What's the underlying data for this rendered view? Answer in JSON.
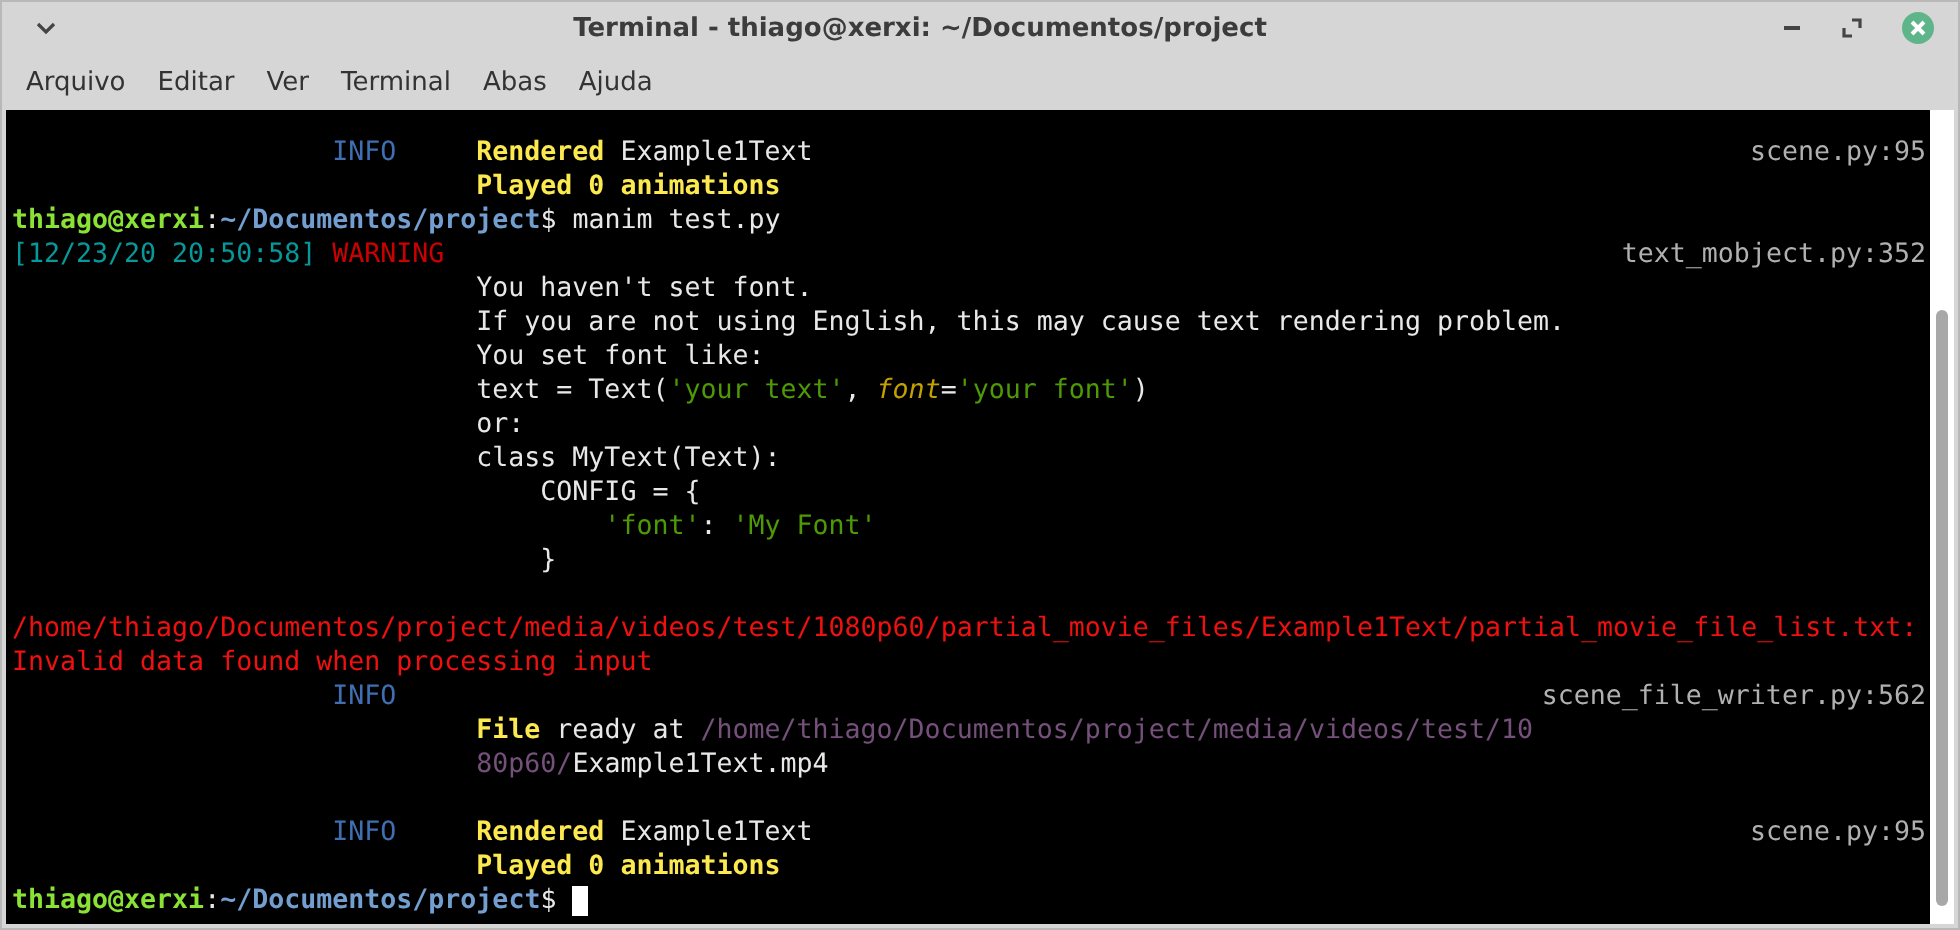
{
  "window": {
    "title": "Terminal - thiago@xerxi: ~/Documentos/project"
  },
  "menu": [
    "Arquivo",
    "Editar",
    "Ver",
    "Terminal",
    "Abas",
    "Ajuda"
  ],
  "lines": [
    {
      "kind": "log",
      "level": {
        "text": "INFO",
        "kind": "info"
      },
      "segments": [
        {
          "text": "Rendered",
          "kind": "bold"
        },
        {
          "text": " Example1Text",
          "kind": "plain"
        }
      ],
      "source": "scene.py:95"
    },
    {
      "kind": "log",
      "segments": [
        {
          "text": "Played 0 animations",
          "kind": "bold"
        }
      ]
    },
    {
      "kind": "prompt",
      "segments": [
        {
          "text": "thiago@xerxi",
          "kind": "user"
        },
        {
          "text": ":",
          "kind": "separator"
        },
        {
          "text": "~/Documentos/project",
          "kind": "path"
        },
        {
          "text": "$",
          "kind": "symbol"
        },
        {
          "text": "manim test.py",
          "kind": "command"
        }
      ],
      "cursor": false
    },
    {
      "kind": "log",
      "timestamp": "[12/23/20 20:50:58]",
      "level": {
        "text": "WARNING",
        "kind": "warning"
      },
      "source": "text_mobject.py:352"
    },
    {
      "kind": "log",
      "segments": [
        {
          "text": "You haven't set font.",
          "kind": "plain"
        }
      ]
    },
    {
      "kind": "log",
      "segments": [
        {
          "text": "If you are not using English, this may cause text rendering problem.",
          "kind": "plain"
        }
      ]
    },
    {
      "kind": "log",
      "segments": [
        {
          "text": "You set font like:",
          "kind": "plain"
        }
      ]
    },
    {
      "kind": "log",
      "segments": [
        {
          "text": "text = Text(",
          "kind": "plain"
        },
        {
          "text": "'your text'",
          "kind": "string"
        },
        {
          "text": ", ",
          "kind": "plain"
        },
        {
          "text": "font",
          "kind": "keyword"
        },
        {
          "text": "=",
          "kind": "plain"
        },
        {
          "text": "'your font'",
          "kind": "string"
        },
        {
          "text": ")",
          "kind": "plain"
        }
      ]
    },
    {
      "kind": "log",
      "segments": [
        {
          "text": "or:",
          "kind": "plain"
        }
      ]
    },
    {
      "kind": "log",
      "segments": [
        {
          "text": "class MyText(Text):",
          "kind": "plain"
        }
      ]
    },
    {
      "kind": "log",
      "segments": [
        {
          "text": "    CONFIG = {",
          "kind": "plain"
        }
      ]
    },
    {
      "kind": "log",
      "segments": [
        {
          "text": "        'font'",
          "kind": "string"
        },
        {
          "text": ": ",
          "kind": "plain"
        },
        {
          "text": "'My Font'",
          "kind": "string"
        }
      ]
    },
    {
      "kind": "log",
      "segments": [
        {
          "text": "    }",
          "kind": "plain"
        }
      ]
    },
    {
      "kind": "blank"
    },
    {
      "kind": "error",
      "text": "/home/thiago/Documentos/project/media/videos/test/1080p60/partial_movie_files/Example1Text/partial_movie_file_list.txt:"
    },
    {
      "kind": "error",
      "text": "Invalid data found when processing input"
    },
    {
      "kind": "log",
      "level": {
        "text": "INFO",
        "kind": "info"
      },
      "source": "scene_file_writer.py:562"
    },
    {
      "kind": "log",
      "segments": [
        {
          "text": "File",
          "kind": "bold"
        },
        {
          "text": " ready at ",
          "kind": "plain"
        },
        {
          "text": "/home/thiago/Documentos/project/media/videos/test/10",
          "kind": "path"
        }
      ]
    },
    {
      "kind": "log",
      "segments": [
        {
          "text": "80p60/",
          "kind": "path"
        },
        {
          "text": "Example1Text.mp4",
          "kind": "plain"
        }
      ]
    },
    {
      "kind": "blank"
    },
    {
      "kind": "log",
      "level": {
        "text": "INFO",
        "kind": "info"
      },
      "segments": [
        {
          "text": "Rendered",
          "kind": "bold"
        },
        {
          "text": " Example1Text",
          "kind": "plain"
        }
      ],
      "source": "scene.py:95"
    },
    {
      "kind": "log",
      "segments": [
        {
          "text": "Played 0 animations",
          "kind": "bold"
        }
      ]
    },
    {
      "kind": "prompt",
      "segments": [
        {
          "text": "thiago@xerxi",
          "kind": "user"
        },
        {
          "text": ":",
          "kind": "separator"
        },
        {
          "text": "~/Documentos/project",
          "kind": "path"
        },
        {
          "text": "$",
          "kind": "symbol"
        }
      ],
      "cursor": true
    }
  ]
}
